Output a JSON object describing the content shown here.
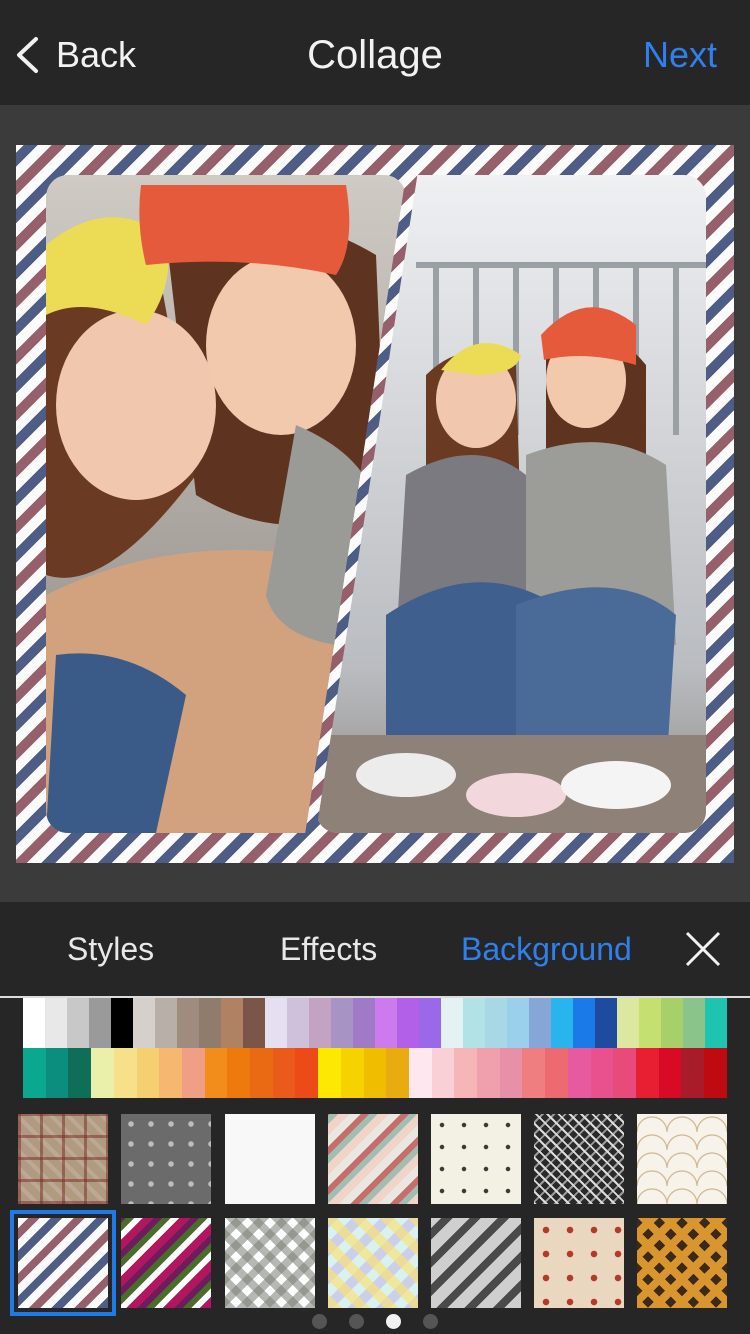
{
  "header": {
    "back_label": "Back",
    "title": "Collage",
    "next_label": "Next"
  },
  "canvas": {
    "background_pattern": "diagonal-stripes-blue-red",
    "photos": [
      {
        "name": "photo-left",
        "icon": "photo"
      },
      {
        "name": "photo-right",
        "icon": "photo"
      }
    ]
  },
  "tabs": [
    {
      "label": "Styles",
      "active": false
    },
    {
      "label": "Effects",
      "active": false
    },
    {
      "label": "Background",
      "active": true
    }
  ],
  "colors": {
    "accent": "#2f80ed",
    "top_bar": "#262626",
    "swatches_row1": [
      "#ffffff",
      "#e8e8e8",
      "#c8c8c8",
      "#9a9a9a",
      "#000000",
      "#d6d0cc",
      "#b8b0a8",
      "#a08c7e",
      "#8f7c6c",
      "#b08264",
      "#7a5548",
      "#e4e0f2",
      "#cfc0dc",
      "#c4a2c4",
      "#a894c4",
      "#a07ac6",
      "#cc7aee",
      "#b260e8",
      "#9a68e8",
      "#e4f2f4",
      "#b2e2e6",
      "#a8d8e6",
      "#9ad0ec",
      "#86a6d8",
      "#2ab4ee",
      "#1a7ae8",
      "#1e4aa0",
      "#dce8a0",
      "#c4e070",
      "#a8d06a",
      "#8ac48a",
      "#1ec4b0"
    ],
    "swatches_row2": [
      "#0aa88e",
      "#0c8e7e",
      "#0e6e58",
      "#eaf0aa",
      "#f6e08a",
      "#f6d070",
      "#f6b870",
      "#f09e86",
      "#f28c1a",
      "#ee7a0e",
      "#ea6a14",
      "#ea5a1a",
      "#ec4a16",
      "#fce800",
      "#f6d200",
      "#f0be00",
      "#e8ac10",
      "#fce8ee",
      "#f8d0d6",
      "#f6b6b8",
      "#f0a0ac",
      "#e890a8",
      "#ee7e80",
      "#ec6a70",
      "#e85aa0",
      "#e8508e",
      "#e84a7c",
      "#e81e32",
      "#d80a26",
      "#a81c2a",
      "#c00a12"
    ]
  },
  "patterns": [
    {
      "name": "pattern-plaid",
      "cls": "p-plaid"
    },
    {
      "name": "pattern-stars-grey",
      "cls": "p-stars"
    },
    {
      "name": "pattern-white",
      "cls": "p-white"
    },
    {
      "name": "pattern-pastel-stripes",
      "cls": "p-pastel"
    },
    {
      "name": "pattern-anchors",
      "cls": "p-anchor"
    },
    {
      "name": "pattern-geometric",
      "cls": "p-geo"
    },
    {
      "name": "pattern-scallops",
      "cls": "p-scallop"
    },
    {
      "name": "pattern-stripes-blue-red",
      "cls": "p-stripe-blue",
      "selected": true
    },
    {
      "name": "pattern-stripes-berry",
      "cls": "p-stripe-berry"
    },
    {
      "name": "pattern-gingham",
      "cls": "p-gingham"
    },
    {
      "name": "pattern-rainbow-check",
      "cls": "p-rainbow"
    },
    {
      "name": "pattern-grey-stripes",
      "cls": "p-grey"
    },
    {
      "name": "pattern-red-stars",
      "cls": "p-redstar"
    },
    {
      "name": "pattern-argyle",
      "cls": "p-argyle"
    }
  ],
  "pager": {
    "total": 4,
    "current": 3
  }
}
